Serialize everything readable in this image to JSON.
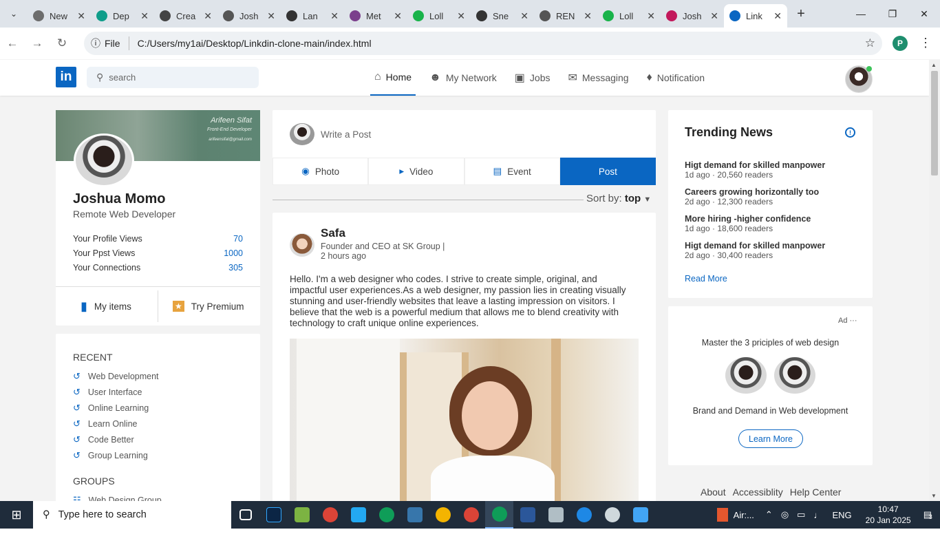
{
  "browser": {
    "tabs": [
      {
        "title": "New",
        "color": "#6d6d6d"
      },
      {
        "title": "Dep",
        "color": "#0f9d8a"
      },
      {
        "title": "Crea",
        "color": "#444444"
      },
      {
        "title": "Josh",
        "color": "#555555"
      },
      {
        "title": "Lan",
        "color": "#333333"
      },
      {
        "title": "Met",
        "color": "#7b3f8c"
      },
      {
        "title": "Loll",
        "color": "#19b34a"
      },
      {
        "title": "Sne",
        "color": "#333333"
      },
      {
        "title": "REN",
        "color": "#555555"
      },
      {
        "title": "Loll",
        "color": "#19b34a"
      },
      {
        "title": "Josh",
        "color": "#c2185b"
      },
      {
        "title": "Link",
        "color": "#0a66c2"
      }
    ],
    "file_chip": "File",
    "url": "C:/Users/my1ai/Desktop/Linkdin-clone-main/index.html",
    "profile_initial": "P"
  },
  "nav": {
    "logo": "in",
    "search_placeholder": "search",
    "items": [
      {
        "label": "Home",
        "icon": "home-icon"
      },
      {
        "label": "My Network",
        "icon": "people-icon"
      },
      {
        "label": "Jobs",
        "icon": "briefcase-icon"
      },
      {
        "label": "Messaging",
        "icon": "chat-icon"
      },
      {
        "label": "Notification",
        "icon": "bell-icon"
      }
    ]
  },
  "profile": {
    "cover_name": "Arifeen Sifat",
    "cover_role": "Front-End Developer",
    "cover_email": "arifeensifat@gmail.com",
    "name": "Joshua Momo",
    "title": "Remote Web Developer",
    "stats": [
      {
        "label": "Your Profile Views",
        "value": "70"
      },
      {
        "label": "Your Ppst Views",
        "value": "1000"
      },
      {
        "label": "Your Connections",
        "value": "305"
      }
    ],
    "my_items": "My items",
    "try_premium": "Try Premium"
  },
  "sidebar": {
    "recent_heading": "RECENT",
    "recent": [
      "Web Development",
      "User Interface",
      "Online Learning",
      "Learn Online",
      "Code Better",
      "Group Learning"
    ],
    "groups_heading": "GROUPS",
    "groups": [
      "Web Design Group"
    ]
  },
  "composer": {
    "placeholder": "Write a Post",
    "buttons": {
      "photo": "Photo",
      "video": "Video",
      "event": "Event",
      "post": "Post"
    }
  },
  "sort": {
    "label": "Sort by:",
    "value": "top"
  },
  "post": {
    "author": "Safa",
    "headline": "Founder and CEO at SK Group |",
    "time": "2 hours ago",
    "text": "Hello. I'm a web designer who codes. I strive to create simple, original, and impactful user experiences.As a web designer, my passion lies in creating visually stunning and user-friendly websites that leave a lasting impression on visitors. I believe that the web is a powerful medium that allows me to blend creativity with technology to craft unique online experiences."
  },
  "trending": {
    "heading": "Trending News",
    "items": [
      {
        "title": "Higt demand for skilled manpower",
        "meta": "1d ago · 20,560 readers"
      },
      {
        "title": "Careers growing horizontally too",
        "meta": "2d ago · 12,300 readers"
      },
      {
        "title": "More hiring -higher confidence",
        "meta": "1d ago · 18,600 readers"
      },
      {
        "title": "Higt demand for skilled manpower",
        "meta": "2d ago · 30,400 readers"
      }
    ],
    "read_more": "Read More"
  },
  "ad": {
    "label": "Ad ···",
    "headline": "Master the 3 priciples of web design",
    "subline": "Brand and Demand in Web development",
    "button": "Learn More"
  },
  "footer": {
    "links": [
      "About",
      "Accessiblity",
      "Help Center"
    ]
  },
  "taskbar": {
    "search_placeholder": "Type here to search",
    "weather": "Air:...",
    "language": "ENG",
    "time": "10:47",
    "date": "20 Jan 2025",
    "notifications": "3"
  },
  "colors": {
    "accent": "#0a66c2",
    "taskbar": "#1f2c3b"
  }
}
